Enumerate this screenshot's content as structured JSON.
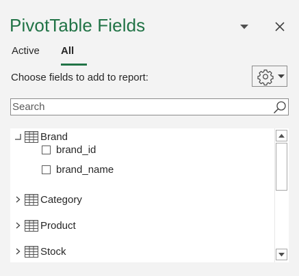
{
  "header": {
    "title": "PivotTable Fields"
  },
  "tabs": [
    {
      "label": "Active",
      "selected": false
    },
    {
      "label": "All",
      "selected": true
    }
  ],
  "choose_label": "Choose fields to add to report:",
  "settings": {
    "icon": "gear-icon",
    "dropdown_icon": "chevron-down-icon"
  },
  "search": {
    "placeholder": "Search",
    "value": ""
  },
  "field_list": {
    "tables": [
      {
        "name": "Brand",
        "expanded": true,
        "fields": [
          {
            "name": "brand_id",
            "checked": false
          },
          {
            "name": "brand_name",
            "checked": false
          }
        ]
      },
      {
        "name": "Category",
        "expanded": false
      },
      {
        "name": "Product",
        "expanded": false
      },
      {
        "name": "Stock",
        "expanded": false
      }
    ]
  },
  "colors": {
    "accent": "#217346",
    "text": "#262626",
    "pane_background": "#f3f3f3"
  }
}
